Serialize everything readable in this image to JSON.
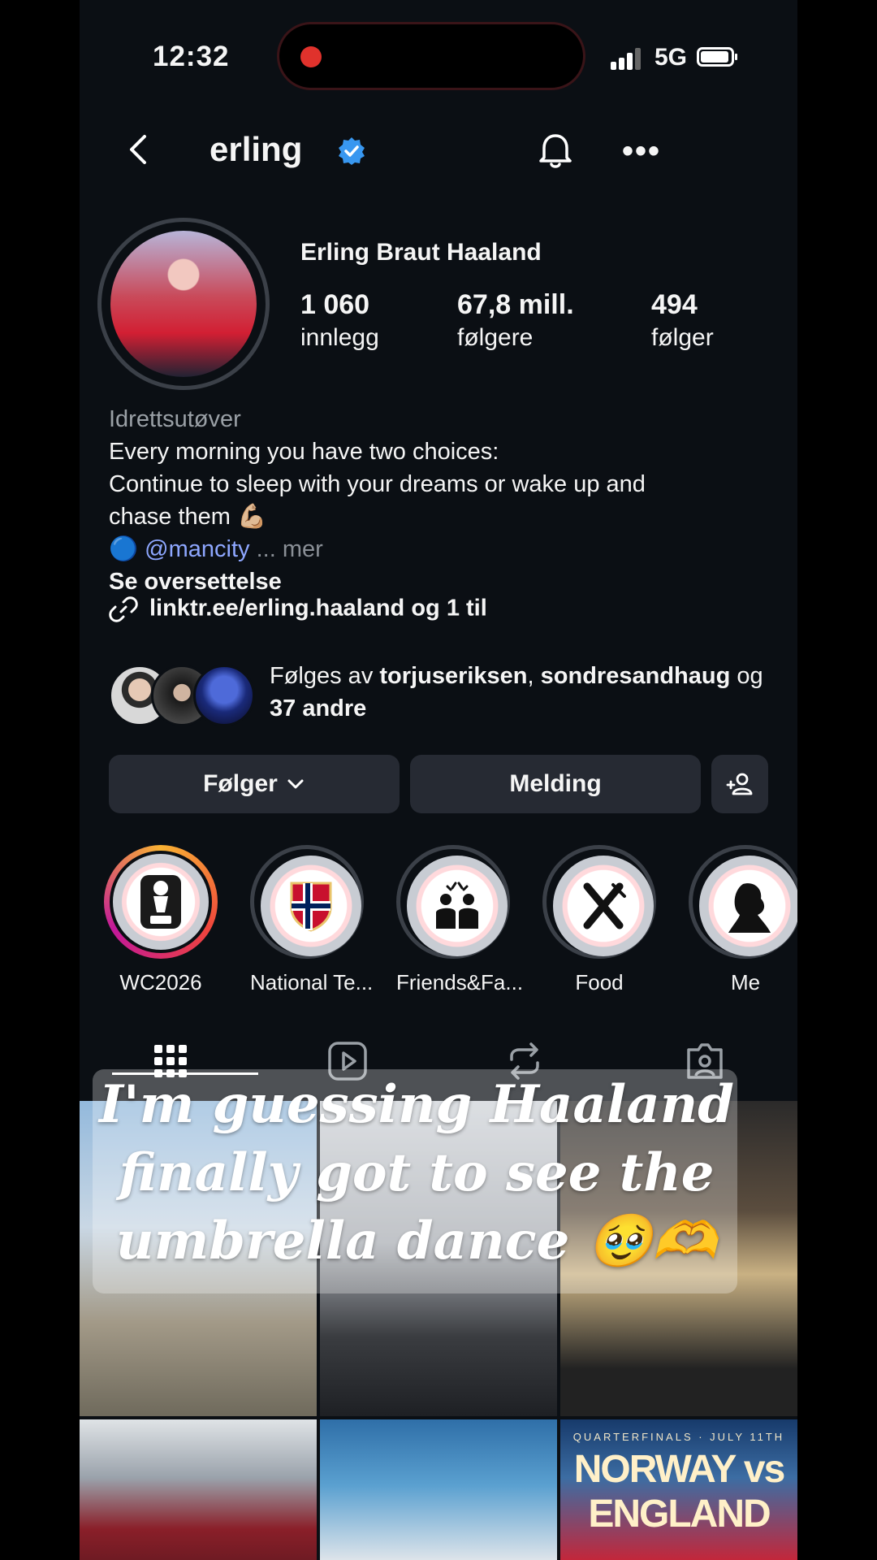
{
  "status": {
    "time": "12:32",
    "network": "5G"
  },
  "header": {
    "username": "erling"
  },
  "profile": {
    "full_name": "Erling Braut Haaland",
    "stats": [
      {
        "value": "1 060",
        "label": "innlegg"
      },
      {
        "value": "67,8 mill.",
        "label": "følgere"
      },
      {
        "value": "494",
        "label": "følger"
      }
    ],
    "category": "Idrettsutøver",
    "bio_line1": "Every morning you have two choices:",
    "bio_line2": "Continue to sleep with your dreams or wake up and",
    "bio_line3": "chase them 💪🏼",
    "mention_prefix": "🔵",
    "mention": "@mancity",
    "more": "... mer",
    "translate": "Se oversettelse",
    "link": "linktr.ee/erling.haaland og 1 til"
  },
  "followed_by": {
    "prefix": "Følges av",
    "user1": "torjuseriksen",
    "sep": ",",
    "user2": "sondresandhaug",
    "og": "og",
    "others": "37 andre"
  },
  "buttons": {
    "follow": "Følger",
    "message": "Melding"
  },
  "highlights": [
    {
      "label": "WC2026"
    },
    {
      "label": "National Te..."
    },
    {
      "label": "Friends&Fa..."
    },
    {
      "label": "Food"
    },
    {
      "label": "Me"
    }
  ],
  "grid_tile": {
    "subtitle": "QUARTERFINALS · JULY 11TH",
    "title": "NORWAY vs ENGLAND"
  },
  "overlay_caption": "I'm guessing Haaland finally got to see the umbrella dance 🥹🫶"
}
